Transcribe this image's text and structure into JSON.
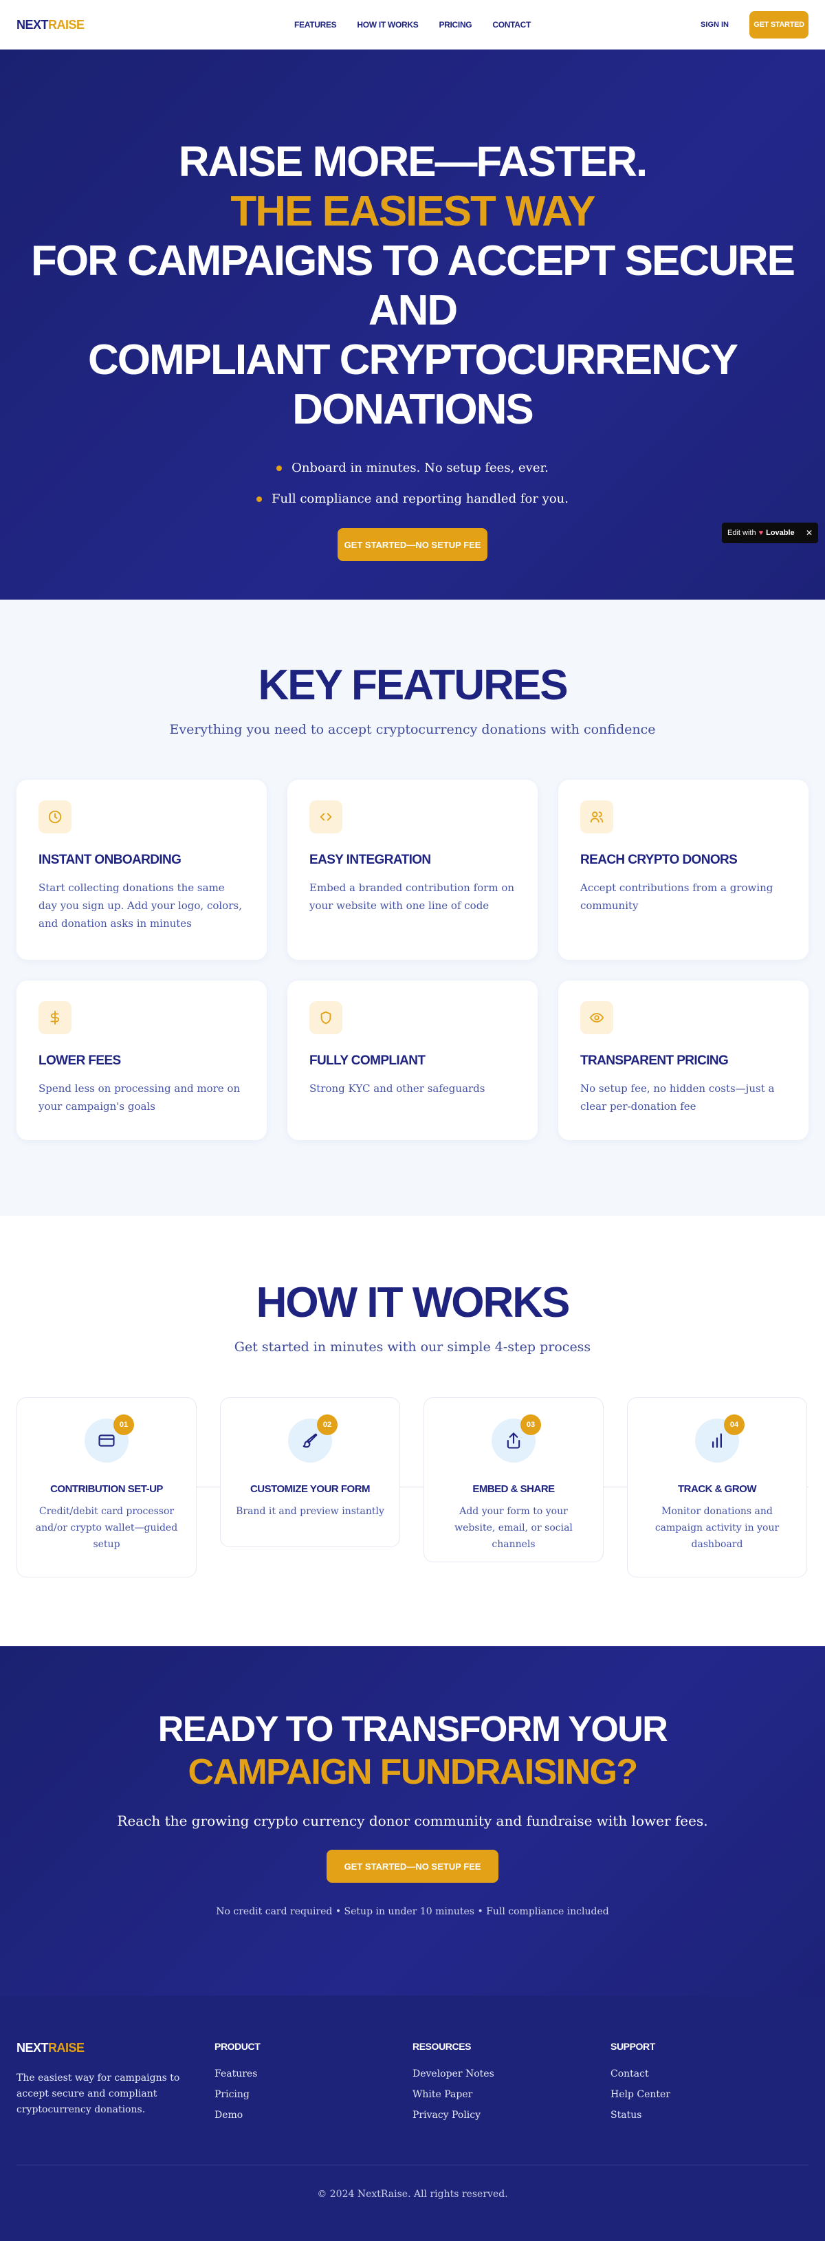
{
  "nav": {
    "logo_a": "NEXT",
    "logo_b": "RAISE",
    "links": [
      "FEATURES",
      "HOW IT WORKS",
      "PRICING",
      "CONTACT"
    ],
    "sign_in": "SIGN IN",
    "get_started": "GET STARTED"
  },
  "hero": {
    "line1": "RAISE MORE—FASTER.",
    "line2": "THE EASIEST WAY",
    "line3": "FOR CAMPAIGNS TO ACCEPT SECURE AND",
    "line4": "COMPLIANT CRYPTOCURRENCY",
    "line5": "DONATIONS",
    "bullets": [
      "Onboard in minutes. No setup fees, ever.",
      "Full compliance and reporting handled for you."
    ],
    "cta": "GET STARTED—NO SETUP FEE"
  },
  "lovable": {
    "edit_with": "Edit with",
    "brand": "Lovable",
    "close": "✕"
  },
  "features": {
    "title": "KEY FEATURES",
    "subtitle": "Everything you need to accept cryptocurrency donations with confidence",
    "items": [
      {
        "icon": "clock-icon",
        "title": "INSTANT ONBOARDING",
        "desc": "Start collecting donations the same day you sign up. Add your logo, colors, and donation asks in minutes"
      },
      {
        "icon": "code-icon",
        "title": "EASY INTEGRATION",
        "desc": "Embed a branded contribution form on your website with one line of code"
      },
      {
        "icon": "users-icon",
        "title": "REACH CRYPTO DONORS",
        "desc": "Accept contributions from a growing community"
      },
      {
        "icon": "dollar-icon",
        "title": "LOWER FEES",
        "desc": "Spend less on processing and more on your campaign's goals"
      },
      {
        "icon": "shield-icon",
        "title": "FULLY COMPLIANT",
        "desc": "Strong KYC and other safeguards"
      },
      {
        "icon": "eye-icon",
        "title": "TRANSPARENT PRICING",
        "desc": "No setup fee, no hidden costs—just a clear per-donation fee"
      }
    ]
  },
  "how": {
    "title": "HOW IT WORKS",
    "subtitle": "Get started in minutes with our simple 4-step process",
    "steps": [
      {
        "num": "01",
        "icon": "credit-card-icon",
        "title": "CONTRIBUTION SET-UP",
        "desc": "Credit/debit card processor and/or crypto wallet—guided setup"
      },
      {
        "num": "02",
        "icon": "brush-icon",
        "title": "CUSTOMIZE YOUR FORM",
        "desc": "Brand it and preview instantly"
      },
      {
        "num": "03",
        "icon": "share-icon",
        "title": "EMBED & SHARE",
        "desc": "Add your form to your website, email, or social channels"
      },
      {
        "num": "04",
        "icon": "bar-chart-icon",
        "title": "TRACK & GROW",
        "desc": "Monitor donations and campaign activity in your dashboard"
      }
    ]
  },
  "cta": {
    "line1": "READY TO TRANSFORM YOUR",
    "line2": "CAMPAIGN FUNDRAISING?",
    "lead": "Reach the growing crypto currency donor community and fundraise with lower fees.",
    "button": "GET STARTED—NO SETUP FEE",
    "note": "No credit card required • Setup in under 10 minutes • Full compliance included"
  },
  "footer": {
    "desc": "The easiest way for campaigns to accept secure and compliant cryptocurrency donations.",
    "cols": [
      {
        "title": "PRODUCT",
        "items": [
          "Features",
          "Pricing",
          "Demo"
        ]
      },
      {
        "title": "RESOURCES",
        "items": [
          "Developer Notes",
          "White Paper",
          "Privacy Policy"
        ]
      },
      {
        "title": "SUPPORT",
        "items": [
          "Contact",
          "Help Center",
          "Status"
        ]
      }
    ],
    "copyright": "© 2024 NextRaise. All rights reserved."
  },
  "colors": {
    "navy": "#1e2380",
    "gold": "#e2a117",
    "hero_bg": "#1f2480",
    "features_bg": "#f4f8fd"
  }
}
